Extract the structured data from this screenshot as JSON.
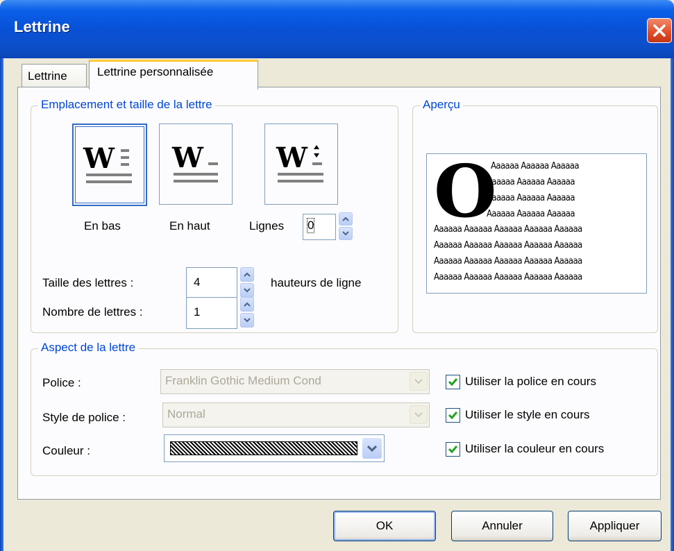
{
  "dialog": {
    "title": "Lettrine"
  },
  "tabs": [
    {
      "label": "Lettrine",
      "active": false
    },
    {
      "label": "Lettrine personnalisée",
      "active": true
    }
  ],
  "placement": {
    "legend": "Emplacement et taille de la lettre",
    "options": [
      {
        "label": "En bas",
        "icon": "dropcap-bottom-icon",
        "selected": true
      },
      {
        "label": "En haut",
        "icon": "dropcap-top-icon",
        "selected": false
      },
      {
        "label": "Lignes",
        "icon": "dropcap-lines-icon",
        "selected": false
      }
    ],
    "lines_value": "0",
    "size_label": "Taille des lettres :",
    "size_value": "4",
    "size_unit": "hauteurs de ligne",
    "count_label": "Nombre de lettres :",
    "count_value": "1"
  },
  "preview": {
    "legend": "Aperçu",
    "dropcap_letter": "O",
    "short_lines": [
      "Aaaaaa Aaaaaa Aaaaaa",
      "Aaaaaa Aaaaaa Aaaaaa",
      "Aaaaaa Aaaaaa Aaaaaa",
      "Aaaaaa Aaaaaa Aaaaaa"
    ],
    "long_lines": [
      "Aaaaaa Aaaaaa Aaaaaa Aaaaaa Aaaaaa",
      "Aaaaaa Aaaaaa Aaaaaa Aaaaaa Aaaaaa",
      "Aaaaaa Aaaaaa Aaaaaa Aaaaaa Aaaaaa",
      "Aaaaaa Aaaaaa Aaaaaa Aaaaaa Aaaaaa"
    ]
  },
  "appearance": {
    "legend": "Aspect de la lettre",
    "font_label": "Police :",
    "font_value": "Franklin Gothic Medium Cond",
    "style_label": "Style de police :",
    "style_value": "Normal",
    "color_label": "Couleur :",
    "use_font": {
      "label": "Utiliser la police en cours",
      "checked": true
    },
    "use_style": {
      "label": "Utiliser le style en cours",
      "checked": true
    },
    "use_color": {
      "label": "Utiliser la couleur en cours",
      "checked": true
    }
  },
  "buttons": {
    "ok": "OK",
    "cancel": "Annuler",
    "apply": "Appliquer"
  },
  "colors": {
    "titlebar": "#0851d6",
    "legend_text": "#0046d5",
    "dialog_bg": "#ece9d8",
    "checkmark": "#21a121"
  }
}
